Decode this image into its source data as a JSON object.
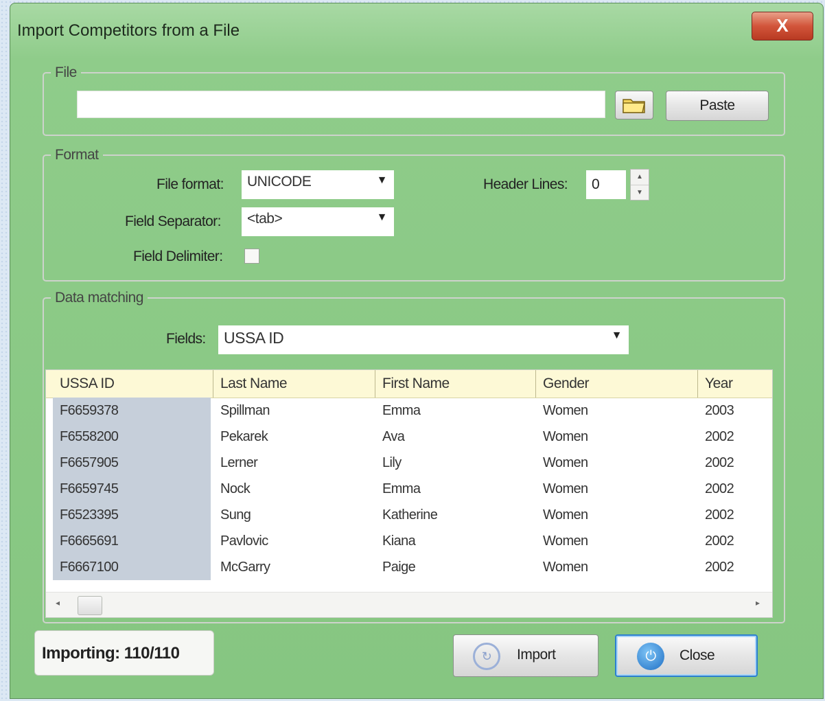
{
  "window": {
    "title": "Import Competitors from a File",
    "close_glyph": "X"
  },
  "file": {
    "legend": "File",
    "path_value": "",
    "browse_icon": "folder-icon",
    "paste_label": "Paste"
  },
  "format": {
    "legend": "Format",
    "file_format_label": "File format:",
    "file_format_value": "UNICODE",
    "field_separator_label": "Field Separator:",
    "field_separator_value": "<tab>",
    "field_delimiter_label": "Field Delimiter:",
    "field_delimiter_checked": false,
    "header_lines_label": "Header Lines:",
    "header_lines_value": "0"
  },
  "matching": {
    "legend": "Data matching",
    "fields_label": "Fields:",
    "fields_value": "USSA ID"
  },
  "grid": {
    "columns": [
      "USSA ID",
      "Last Name",
      "First Name",
      "Gender",
      "Year"
    ],
    "rows": [
      [
        "F6659378",
        "Spillman",
        "Emma",
        "Women",
        "2003"
      ],
      [
        "F6558200",
        "Pekarek",
        "Ava",
        "Women",
        "2002"
      ],
      [
        "F6657905",
        "Lerner",
        "Lily",
        "Women",
        "2002"
      ],
      [
        "F6659745",
        "Nock",
        "Emma",
        "Women",
        "2002"
      ],
      [
        "F6523395",
        "Sung",
        "Katherine",
        "Women",
        "2002"
      ],
      [
        "F6665691",
        "Pavlovic",
        "Kiana",
        "Women",
        "2002"
      ],
      [
        "F6667100",
        "McGarry",
        "Paige",
        "Women",
        "2002"
      ]
    ]
  },
  "footer": {
    "status": "Importing: 110/110",
    "import_label": "Import",
    "close_label": "Close"
  },
  "colors": {
    "title_bar": "#8fcc8a",
    "close_button": "#d2553b",
    "grid_header": "#fdf9d6",
    "selected_cell": "#c6cfda"
  }
}
